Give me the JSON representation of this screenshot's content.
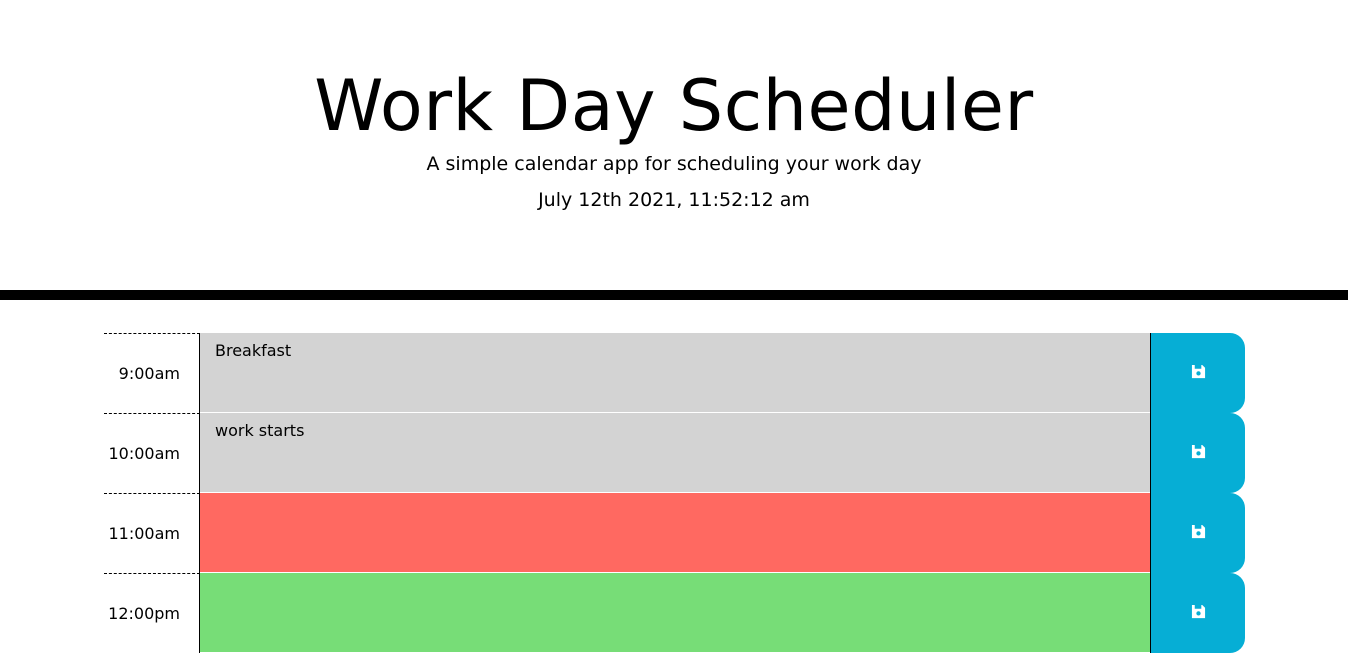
{
  "header": {
    "title": "Work Day Scheduler",
    "subtitle": "A simple calendar app for scheduling your work day",
    "current_day": "July 12th 2021, 11:52:12 am"
  },
  "colors": {
    "past": "#d3d3d3",
    "present": "#ff6961",
    "future": "#77dd77",
    "save_button": "#06aed5"
  },
  "timeblocks": [
    {
      "hour": "9:00am",
      "text": "Breakfast",
      "state": "past",
      "icon": "save-icon"
    },
    {
      "hour": "10:00am",
      "text": "work starts",
      "state": "past",
      "icon": "save-icon"
    },
    {
      "hour": "11:00am",
      "text": "",
      "state": "present",
      "icon": "save-icon"
    },
    {
      "hour": "12:00pm",
      "text": "",
      "state": "future",
      "icon": "save-icon"
    }
  ]
}
